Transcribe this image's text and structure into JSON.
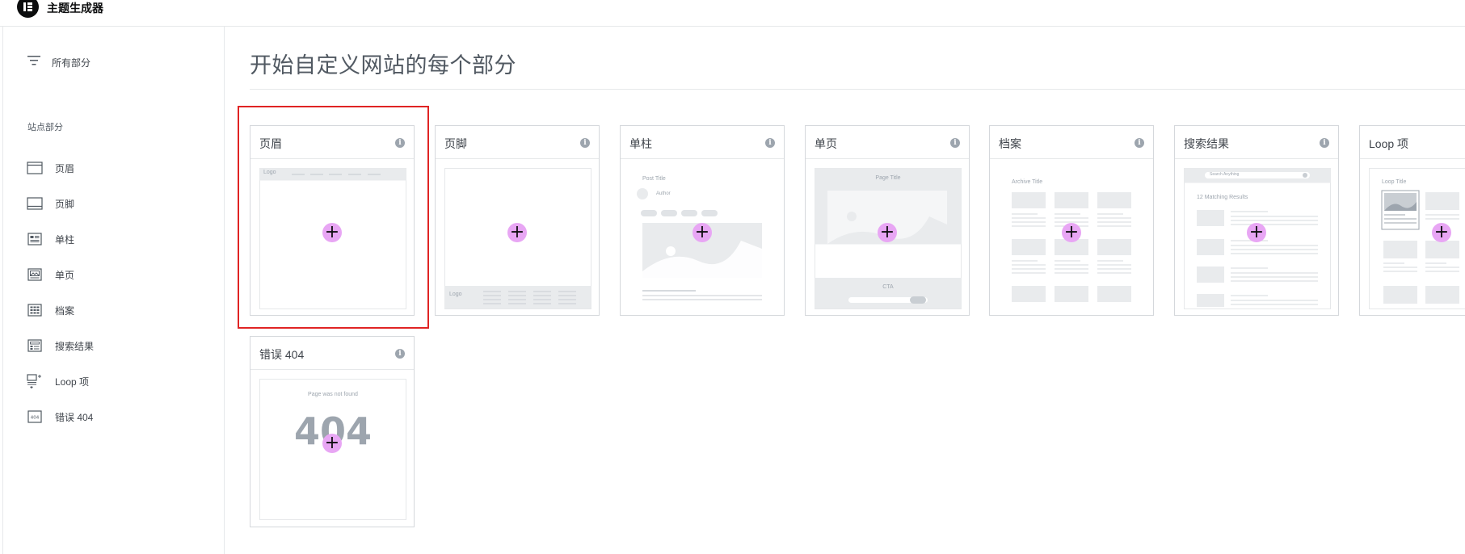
{
  "app": {
    "brand_title": "主题生成器"
  },
  "sidebar": {
    "all_parts_label": "所有部分",
    "section_label": "站点部分",
    "items": [
      {
        "label": "页眉",
        "icon": "header-icon"
      },
      {
        "label": "页脚",
        "icon": "footer-icon"
      },
      {
        "label": "单柱",
        "icon": "single-post-icon"
      },
      {
        "label": "单页",
        "icon": "single-page-icon"
      },
      {
        "label": "档案",
        "icon": "archive-icon"
      },
      {
        "label": "搜索结果",
        "icon": "search-results-icon"
      },
      {
        "label": "Loop 项",
        "icon": "loop-item-icon"
      },
      {
        "label": "错误 404",
        "icon": "error-404-icon"
      }
    ]
  },
  "main": {
    "title": "开始自定义网站的每个部分",
    "cards": [
      {
        "title": "页眉",
        "preview": {
          "logo": "Logo"
        }
      },
      {
        "title": "页脚",
        "preview": {
          "logo": "Logo"
        }
      },
      {
        "title": "单柱",
        "preview": {
          "post_title": "Post Title",
          "author": "Author"
        }
      },
      {
        "title": "单页",
        "preview": {
          "page_title": "Page Title",
          "cta": "CTA"
        }
      },
      {
        "title": "档案",
        "preview": {
          "archive_title": "Archive Title"
        }
      },
      {
        "title": "搜索结果",
        "preview": {
          "search_placeholder": "Search Anything",
          "results": "12 Matching Results"
        }
      },
      {
        "title": "Loop 项",
        "preview": {
          "loop_title": "Loop Title"
        }
      },
      {
        "title": "错误 404",
        "preview": {
          "not_found": "Page was not found",
          "code": "404"
        }
      }
    ],
    "info_glyph": "i",
    "add_glyph": "+"
  },
  "colors": {
    "accent_plus": "#e8a6f4",
    "selection": "#e02424",
    "border": "#d5d8dc"
  }
}
